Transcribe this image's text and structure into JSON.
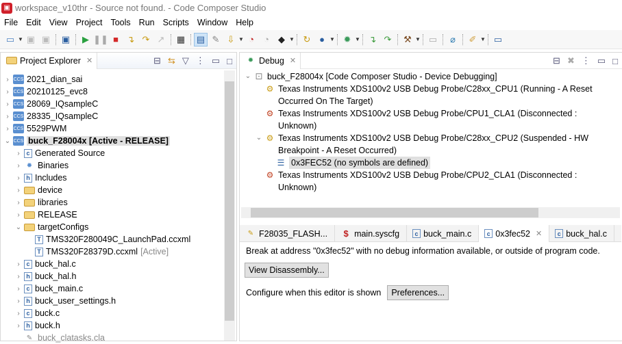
{
  "window": {
    "title": "workspace_v10thr - Source not found. - Code Composer Studio"
  },
  "menu": [
    "File",
    "Edit",
    "View",
    "Project",
    "Tools",
    "Run",
    "Scripts",
    "Window",
    "Help"
  ],
  "toolbar_icons": [
    "new-icon",
    "save-icon",
    "save-all-icon",
    "terminal-icon",
    "resume-icon",
    "suspend-icon",
    "terminate-icon",
    "step-into-icon",
    "step-over-icon",
    "step-return-icon",
    "memory-grid-icon",
    "debug-view-icon",
    "connect-icon",
    "load-program-icon",
    "breakpoint-icon",
    "disabled-breakpoint-icon",
    "flash-icon",
    "restart-icon",
    "build-icon",
    "debug-icon",
    "asm-step-into-icon",
    "asm-step-over-icon",
    "hammer-icon",
    "console-icon",
    "search-icon",
    "pen-icon",
    "new-window-icon"
  ],
  "project_explorer": {
    "title": "Project Explorer",
    "items": [
      {
        "label": "2021_dian_sai",
        "level": 0,
        "expanded": false
      },
      {
        "label": "20210125_evc8",
        "level": 0,
        "expanded": false
      },
      {
        "label": "28069_IQsampleC",
        "level": 0,
        "expanded": false
      },
      {
        "label": "28335_IQsampleC",
        "level": 0,
        "expanded": false
      },
      {
        "label": "5529PWM",
        "level": 0,
        "expanded": false
      },
      {
        "label": "buck_F28004x  [Active - RELEASE]",
        "level": 0,
        "expanded": true,
        "selected": true
      },
      {
        "label": "Generated Source",
        "level": 1
      },
      {
        "label": "Binaries",
        "level": 1
      },
      {
        "label": "Includes",
        "level": 1
      },
      {
        "label": "device",
        "level": 1
      },
      {
        "label": "libraries",
        "level": 1
      },
      {
        "label": "RELEASE",
        "level": 1
      },
      {
        "label": "targetConfigs",
        "level": 1,
        "expanded": true
      },
      {
        "label": "TMS320F280049C_LaunchPad.ccxml",
        "level": 2
      },
      {
        "label": "TMS320F28379D.ccxml",
        "suffix": "[Active]",
        "level": 2
      },
      {
        "label": "buck_hal.c",
        "level": 1
      },
      {
        "label": "buck_hal.h",
        "level": 1
      },
      {
        "label": "buck_main.c",
        "level": 1
      },
      {
        "label": "buck_user_settings.h",
        "level": 1
      },
      {
        "label": "buck.c",
        "level": 1
      },
      {
        "label": "buck.h",
        "level": 1
      },
      {
        "label": "buck_clatasks.cla",
        "level": 1
      }
    ]
  },
  "debug": {
    "title": "Debug",
    "items": [
      {
        "label": "buck_F28004x [Code Composer Studio - Device Debugging]"
      },
      {
        "label": "Texas Instruments XDS100v2 USB Debug Probe/C28xx_CPU1 (Running - A Reset Occurred On The Target)"
      },
      {
        "label": "Texas Instruments XDS100v2 USB Debug Probe/CPU1_CLA1 (Disconnected : Unknown)"
      },
      {
        "label": "Texas Instruments XDS100v2 USB Debug Probe/C28xx_CPU2 (Suspended - HW Breakpoint - A Reset Occurred)"
      },
      {
        "label": "0x3FEC52  (no symbols are defined)"
      },
      {
        "label": "Texas Instruments XDS100v2 USB Debug Probe/CPU2_CLA1 (Disconnected : Unknown)"
      }
    ]
  },
  "editor": {
    "tabs": [
      "F28035_FLASH...",
      "main.syscfg",
      "buck_main.c",
      "0x3fec52",
      "buck_hal.c"
    ],
    "message": "Break at address \"0x3fec52\" with no debug information available, or outside of program code.",
    "view_disassembly": "View Disassembly...",
    "configure_label": "Configure when this editor is shown",
    "preferences": "Preferences..."
  }
}
